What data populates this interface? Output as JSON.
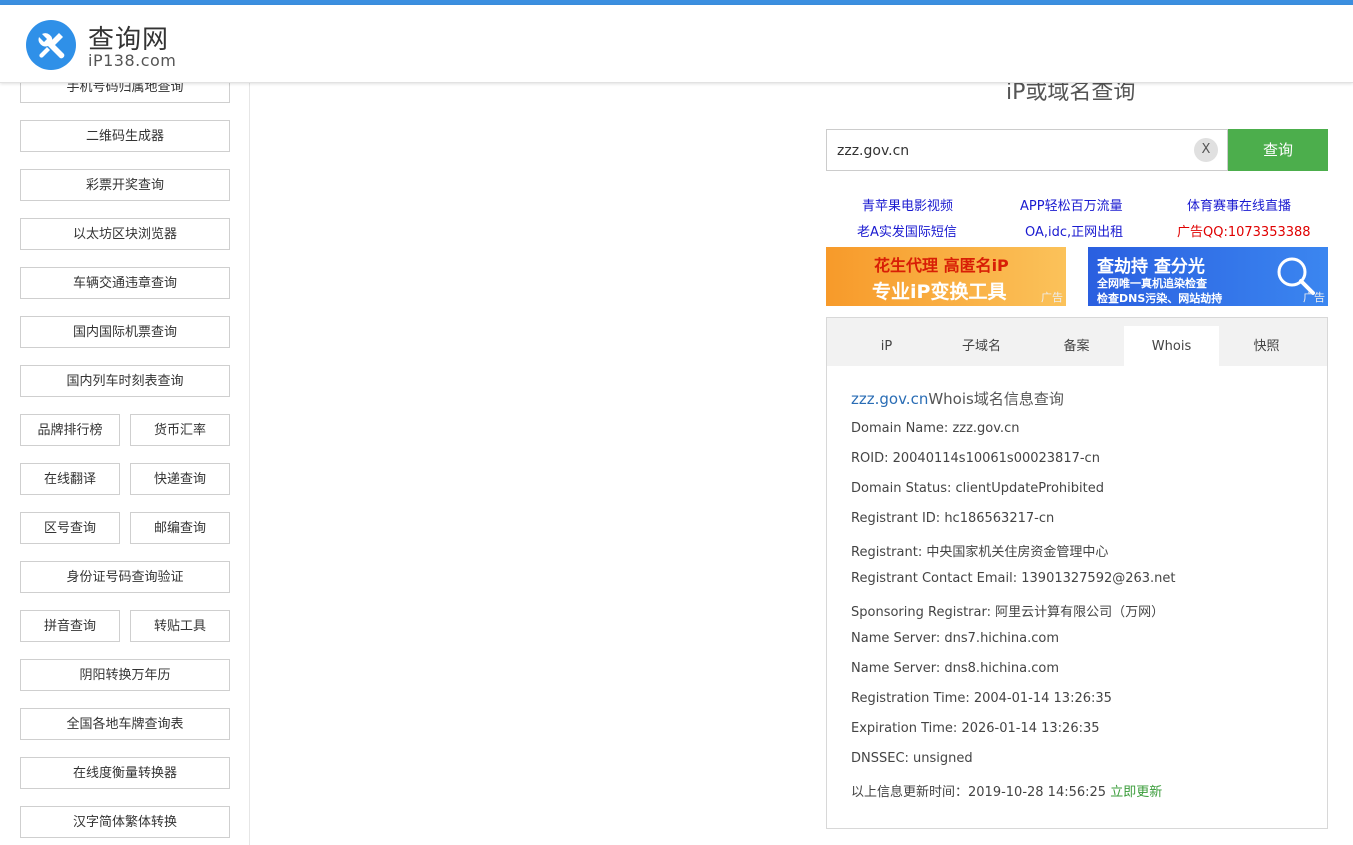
{
  "header": {
    "title": "查询网",
    "subtitle": "iP138.com"
  },
  "sidebar": {
    "items": [
      {
        "label": "手机号码归属地查询"
      },
      {
        "label": "二维码生成器"
      },
      {
        "label": "彩票开奖查询"
      },
      {
        "label": "以太坊区块浏览器"
      },
      {
        "label": "车辆交通违章查询"
      },
      {
        "label": "国内国际机票查询"
      },
      {
        "label": "国内列车时刻表查询"
      },
      {
        "label": "品牌排行榜"
      },
      {
        "label": "货币汇率"
      },
      {
        "label": "在线翻译"
      },
      {
        "label": "快递查询"
      },
      {
        "label": "区号查询"
      },
      {
        "label": "邮编查询"
      },
      {
        "label": "身份证号码查询验证"
      },
      {
        "label": "拼音查询"
      },
      {
        "label": "转贴工具"
      },
      {
        "label": "阴阳转换万年历"
      },
      {
        "label": "全国各地车牌查询表"
      },
      {
        "label": "在线度衡量转换器"
      },
      {
        "label": "汉字简体繁体转换"
      }
    ]
  },
  "main": {
    "title": "iP或域名查询",
    "search": {
      "value": "zzz.gov.cn",
      "clear_label": "X",
      "button_label": "查询"
    },
    "ad_links": [
      {
        "label": "青苹果电影视频"
      },
      {
        "label": "APP轻松百万流量"
      },
      {
        "label": "体育赛事在线直播"
      },
      {
        "label": "老A实发国际短信"
      },
      {
        "label": "OA,idc,正网出租"
      },
      {
        "label": "广告QQ:1073353388"
      }
    ],
    "banners": [
      {
        "line1": "花生代理 高匿名iP",
        "line2": "专业iP变换工具",
        "tag": "广告"
      },
      {
        "line1": "查劫持 查分光",
        "line2": "全网唯一真机追染检查",
        "line3": "检查DNS污染、网站劫持",
        "tag": "广告"
      }
    ],
    "tabs": [
      {
        "label": "iP"
      },
      {
        "label": "子域名"
      },
      {
        "label": "备案"
      },
      {
        "label": "Whois"
      },
      {
        "label": "快照"
      }
    ],
    "whois": {
      "domain": "zzz.gov.cn",
      "title_suffix": "Whois域名信息查询",
      "rows": [
        "Domain Name: zzz.gov.cn",
        "ROID: 20040114s10061s00023817-cn",
        "Domain Status: clientUpdateProhibited",
        "Registrant ID: hc186563217-cn",
        "Registrant: 中央国家机关住房资金管理中心",
        "Registrant Contact Email: 13901327592@263.net",
        "Sponsoring Registrar: 阿里云计算有限公司（万网）",
        "Name Server: dns7.hichina.com",
        "Name Server: dns8.hichina.com",
        "Registration Time: 2004-01-14 13:26:35",
        "Expiration Time: 2026-01-14 13:26:35",
        "DNSSEC: unsigned"
      ],
      "updated_text": "以上信息更新时间：2019-10-28 14:56:25",
      "update_link": "立即更新"
    }
  }
}
